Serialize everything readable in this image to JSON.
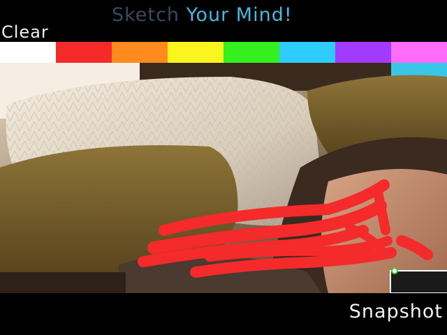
{
  "app": {
    "title_part1": "Sketch",
    "title_part2": "Your Mind!"
  },
  "toolbar": {
    "clear_label": "Clear",
    "snapshot_label": "Snapshot"
  },
  "palette": {
    "clear_swatch_color": "#ffffff",
    "colors": [
      {
        "name": "red",
        "hex": "#f52a2a"
      },
      {
        "name": "orange",
        "hex": "#ff8a1e"
      },
      {
        "name": "yellow",
        "hex": "#fbf51e"
      },
      {
        "name": "green",
        "hex": "#33f01e"
      },
      {
        "name": "cyan",
        "hex": "#2ecbff"
      },
      {
        "name": "purple",
        "hex": "#a23bff"
      },
      {
        "name": "pink",
        "hex": "#ff6cf9"
      }
    ]
  },
  "canvas": {
    "brush_color": "#f52a2a",
    "cursor_ring_color": "#34d02a"
  },
  "theme": {
    "bar_background": "#000000",
    "text_color": "#f2f2f2",
    "title_dim_color": "#3a4a5c",
    "title_accent_color": "#46b8e0"
  }
}
